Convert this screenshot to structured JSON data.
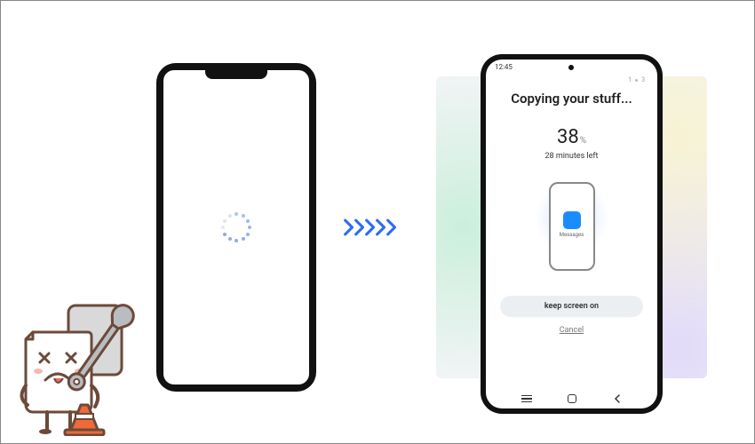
{
  "source_phone": {
    "state": "loading"
  },
  "arrow_count": 5,
  "target_phone": {
    "statusbar": {
      "time": "12:45"
    },
    "steps": {
      "current": "1",
      "total": "3"
    },
    "title": "Copying your stuff...",
    "progress": {
      "value": "38",
      "unit": "%"
    },
    "time_remaining": "28 minutes left",
    "transfer_item": {
      "label": "Messages",
      "meta": ""
    },
    "keep_screen_button": "keep screen on",
    "cancel_link": "Cancel"
  }
}
